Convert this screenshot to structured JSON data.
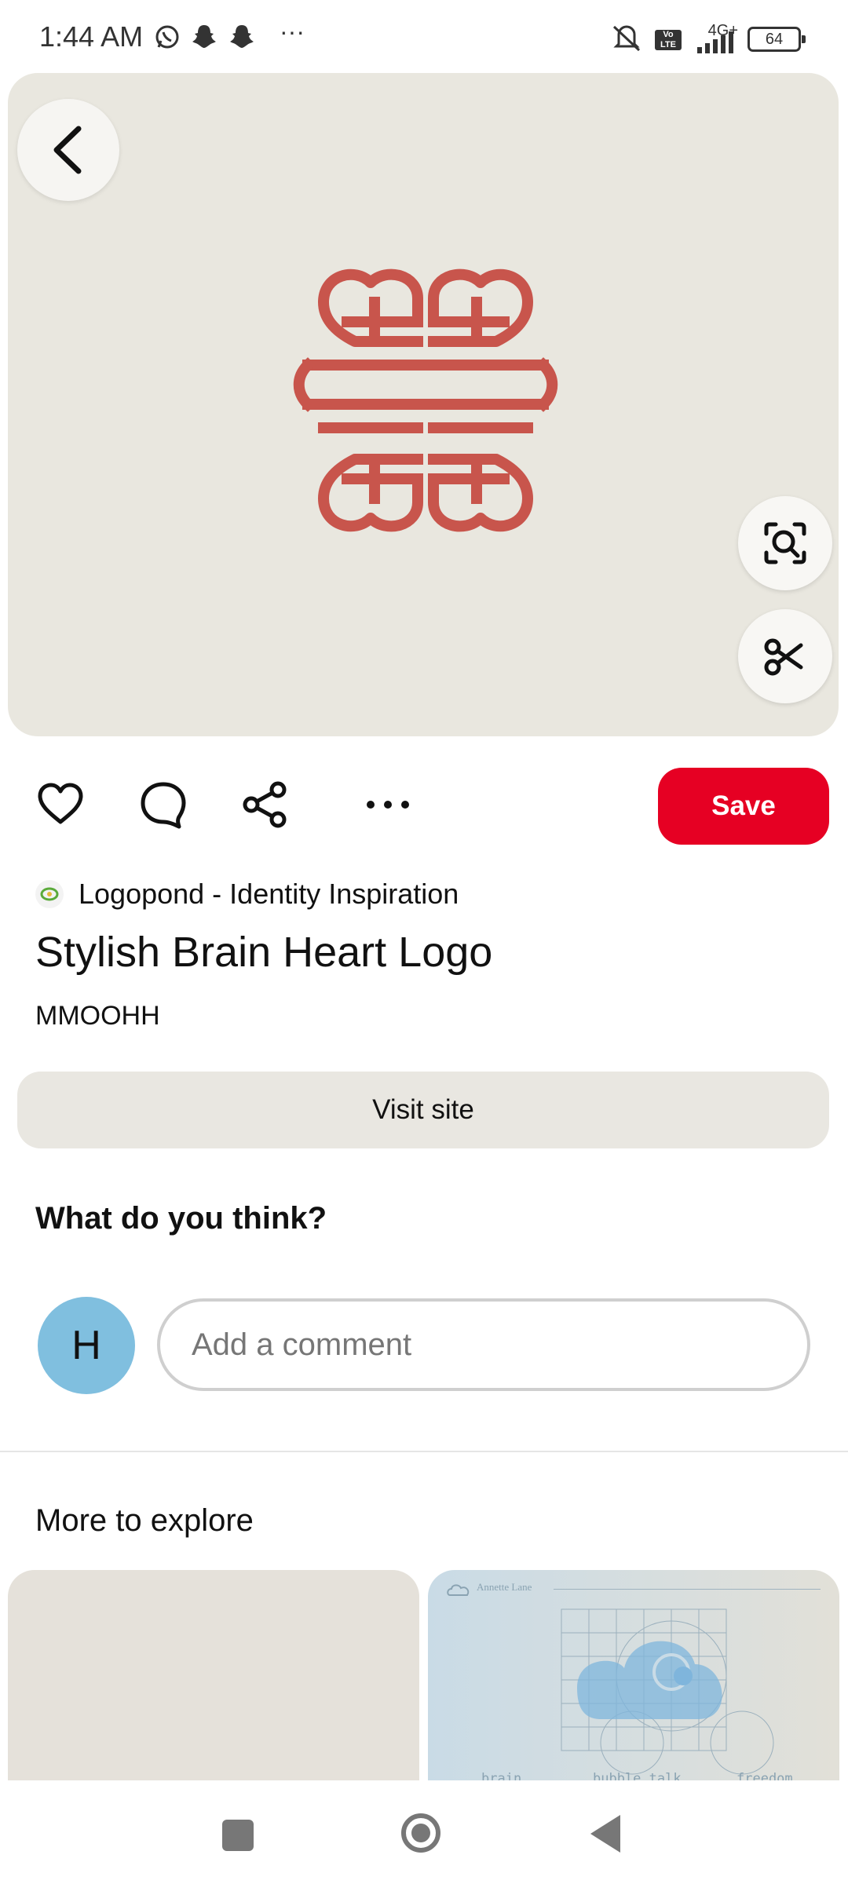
{
  "status_bar": {
    "time": "1:44 AM",
    "network_type": "4G+",
    "volte_label": "Vo LTE",
    "battery": "64",
    "icons": [
      "whatsapp-icon",
      "snapchat-icon",
      "snapchat-icon",
      "more-dots-icon",
      "mute-icon",
      "volte-icon",
      "signal-icon",
      "battery-icon"
    ]
  },
  "pin": {
    "image_alt": "Stylish brain heart logo",
    "logo_color": "#c8554c",
    "background_color": "#e9e7df",
    "source_name": "Logopond - Identity Inspiration",
    "title": "Stylish Brain Heart Logo",
    "author": "MMOOHH"
  },
  "actions": {
    "save_label": "Save",
    "visit_label": "Visit site",
    "icons": [
      "heart-icon",
      "comment-icon",
      "share-icon",
      "more-icon"
    ]
  },
  "comments": {
    "heading": "What do you think?",
    "avatar_initial": "H",
    "placeholder": "Add a comment"
  },
  "explore": {
    "heading": "More to explore",
    "tile2": {
      "brand": "Annette Lane",
      "captions": [
        "brain",
        "bubble talk",
        "freedom"
      ]
    }
  },
  "colors": {
    "accent": "#e60023",
    "avatar": "#80bfdf"
  }
}
